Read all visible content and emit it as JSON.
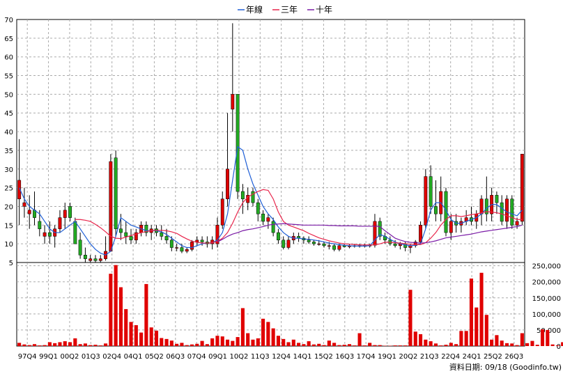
{
  "legend": [
    {
      "name": "年線",
      "color": "#1f5fd6"
    },
    {
      "name": "三年",
      "color": "#e8244a"
    },
    {
      "name": "十年",
      "color": "#7a1aa6"
    }
  ],
  "footer_text": "資料日期: 09/18  (Goodinfo.tw)",
  "chart_data": [
    {
      "type": "candlestick",
      "panel": "price",
      "ylim": [
        5,
        70
      ],
      "ytick_labels": [
        "5",
        "10",
        "15",
        "20",
        "25",
        "30",
        "35",
        "40",
        "45",
        "50",
        "55",
        "60",
        "65",
        "70"
      ],
      "xtick_labels": [
        "97Q4",
        "99Q1",
        "00Q2",
        "01Q3",
        "02Q4",
        "04Q1",
        "05Q2",
        "06Q3",
        "07Q4",
        "09Q1",
        "10Q2",
        "11Q3",
        "12Q4",
        "14Q1",
        "15Q2",
        "16Q3",
        "17Q4",
        "19Q1",
        "20Q2",
        "21Q3",
        "22Q4",
        "24Q1",
        "25Q2",
        "26Q3"
      ],
      "up_color": "#e00000",
      "down_color": "#22aa22",
      "candles": [
        {
          "o": 22,
          "h": 38,
          "l": 15,
          "c": 27
        },
        {
          "o": 20,
          "h": 25,
          "l": 17,
          "c": 21
        },
        {
          "o": 18,
          "h": 23,
          "l": 14,
          "c": 19
        },
        {
          "o": 19,
          "h": 24,
          "l": 15,
          "c": 17
        },
        {
          "o": 16,
          "h": 19,
          "l": 12,
          "c": 14
        },
        {
          "o": 12,
          "h": 15,
          "l": 10,
          "c": 13
        },
        {
          "o": 13,
          "h": 16,
          "l": 10,
          "c": 12
        },
        {
          "o": 12,
          "h": 15,
          "l": 9,
          "c": 14
        },
        {
          "o": 14,
          "h": 19,
          "l": 13,
          "c": 17
        },
        {
          "o": 17,
          "h": 21,
          "l": 14,
          "c": 19
        },
        {
          "o": 20,
          "h": 21,
          "l": 16,
          "c": 17
        },
        {
          "o": 16,
          "h": 17,
          "l": 10,
          "c": 10
        },
        {
          "o": 11,
          "h": 13,
          "l": 6,
          "c": 7
        },
        {
          "o": 7,
          "h": 9,
          "l": 5,
          "c": 6
        },
        {
          "o": 5.5,
          "h": 7,
          "l": 5,
          "c": 6
        },
        {
          "o": 6,
          "h": 7,
          "l": 5,
          "c": 5.5
        },
        {
          "o": 5.5,
          "h": 7,
          "l": 5,
          "c": 6
        },
        {
          "o": 6,
          "h": 12,
          "l": 5.5,
          "c": 8
        },
        {
          "o": 8,
          "h": 34,
          "l": 8,
          "c": 32
        },
        {
          "o": 33,
          "h": 35,
          "l": 12,
          "c": 14
        },
        {
          "o": 14,
          "h": 18,
          "l": 11,
          "c": 13
        },
        {
          "o": 13,
          "h": 16,
          "l": 10,
          "c": 12
        },
        {
          "o": 12,
          "h": 14,
          "l": 10,
          "c": 11
        },
        {
          "o": 11,
          "h": 14,
          "l": 10,
          "c": 13
        },
        {
          "o": 13,
          "h": 16,
          "l": 12,
          "c": 15
        },
        {
          "o": 15,
          "h": 16,
          "l": 12,
          "c": 13
        },
        {
          "o": 13,
          "h": 15,
          "l": 11,
          "c": 14
        },
        {
          "o": 14,
          "h": 15,
          "l": 12,
          "c": 13
        },
        {
          "o": 13,
          "h": 15,
          "l": 11,
          "c": 12
        },
        {
          "o": 12,
          "h": 14,
          "l": 10,
          "c": 11
        },
        {
          "o": 11,
          "h": 12,
          "l": 8,
          "c": 9
        },
        {
          "o": 9,
          "h": 10,
          "l": 8,
          "c": 9
        },
        {
          "o": 9,
          "h": 10,
          "l": 7.5,
          "c": 8
        },
        {
          "o": 8,
          "h": 9,
          "l": 7.5,
          "c": 8.5
        },
        {
          "o": 8.5,
          "h": 11,
          "l": 8,
          "c": 10.5
        },
        {
          "o": 10.5,
          "h": 12,
          "l": 9.5,
          "c": 11
        },
        {
          "o": 11,
          "h": 12,
          "l": 9.5,
          "c": 10.5
        },
        {
          "o": 10.5,
          "h": 12,
          "l": 9,
          "c": 10
        },
        {
          "o": 10,
          "h": 12,
          "l": 8.5,
          "c": 11
        },
        {
          "o": 10,
          "h": 17,
          "l": 9,
          "c": 15
        },
        {
          "o": 15,
          "h": 24,
          "l": 14,
          "c": 22
        },
        {
          "o": 22,
          "h": 45,
          "l": 20,
          "c": 30
        },
        {
          "o": 46,
          "h": 69,
          "l": 40,
          "c": 50
        },
        {
          "o": 50,
          "h": 50,
          "l": 22,
          "c": 24
        },
        {
          "o": 24,
          "h": 26,
          "l": 18,
          "c": 22
        },
        {
          "o": 21,
          "h": 25,
          "l": 19,
          "c": 23
        },
        {
          "o": 24,
          "h": 25,
          "l": 20,
          "c": 21
        },
        {
          "o": 21,
          "h": 22,
          "l": 16,
          "c": 18
        },
        {
          "o": 18,
          "h": 19,
          "l": 15,
          "c": 16
        },
        {
          "o": 16,
          "h": 18,
          "l": 14,
          "c": 17
        },
        {
          "o": 16,
          "h": 17,
          "l": 12,
          "c": 13
        },
        {
          "o": 13,
          "h": 14,
          "l": 10,
          "c": 11
        },
        {
          "o": 11,
          "h": 12,
          "l": 8.5,
          "c": 9
        },
        {
          "o": 9,
          "h": 12,
          "l": 8.5,
          "c": 11
        },
        {
          "o": 11,
          "h": 13,
          "l": 10,
          "c": 12
        },
        {
          "o": 12,
          "h": 13,
          "l": 10.5,
          "c": 11.5
        },
        {
          "o": 11.5,
          "h": 12,
          "l": 10,
          "c": 11
        },
        {
          "o": 11,
          "h": 12,
          "l": 10,
          "c": 10.5
        },
        {
          "o": 10.5,
          "h": 11,
          "l": 9.5,
          "c": 10
        },
        {
          "o": 10,
          "h": 11,
          "l": 9.5,
          "c": 10
        },
        {
          "o": 10,
          "h": 10.5,
          "l": 9,
          "c": 9.5
        },
        {
          "o": 9.5,
          "h": 10.5,
          "l": 8.5,
          "c": 9.5
        },
        {
          "o": 9.5,
          "h": 10,
          "l": 8,
          "c": 8.5
        },
        {
          "o": 8.5,
          "h": 10,
          "l": 8,
          "c": 9.5
        },
        {
          "o": 9.5,
          "h": 10,
          "l": 9,
          "c": 9.2
        },
        {
          "o": 9.2,
          "h": 10,
          "l": 8.8,
          "c": 9.5
        },
        {
          "o": 9.5,
          "h": 10,
          "l": 9,
          "c": 9.3
        },
        {
          "o": 9.3,
          "h": 10,
          "l": 9,
          "c": 9.5
        },
        {
          "o": 9.5,
          "h": 10,
          "l": 9,
          "c": 9.4
        },
        {
          "o": 9.4,
          "h": 10,
          "l": 9,
          "c": 9.6
        },
        {
          "o": 9.6,
          "h": 18,
          "l": 9,
          "c": 16
        },
        {
          "o": 16,
          "h": 17,
          "l": 11,
          "c": 12
        },
        {
          "o": 12,
          "h": 13,
          "l": 10,
          "c": 11
        },
        {
          "o": 11,
          "h": 12,
          "l": 9.5,
          "c": 10
        },
        {
          "o": 10,
          "h": 11,
          "l": 9,
          "c": 9.5
        },
        {
          "o": 9.5,
          "h": 10.5,
          "l": 8.5,
          "c": 10
        },
        {
          "o": 10,
          "h": 10.5,
          "l": 8,
          "c": 9
        },
        {
          "o": 9,
          "h": 10,
          "l": 7.5,
          "c": 9.5
        },
        {
          "o": 9.5,
          "h": 11,
          "l": 9,
          "c": 10.5
        },
        {
          "o": 10.5,
          "h": 16,
          "l": 10,
          "c": 15
        },
        {
          "o": 15,
          "h": 30,
          "l": 14,
          "c": 28
        },
        {
          "o": 28,
          "h": 31,
          "l": 18,
          "c": 20
        },
        {
          "o": 20,
          "h": 27,
          "l": 16,
          "c": 18
        },
        {
          "o": 18,
          "h": 28,
          "l": 16,
          "c": 24
        },
        {
          "o": 24,
          "h": 25,
          "l": 12,
          "c": 13
        },
        {
          "o": 13,
          "h": 18,
          "l": 11,
          "c": 16
        },
        {
          "o": 16,
          "h": 18,
          "l": 13,
          "c": 15
        },
        {
          "o": 15,
          "h": 17,
          "l": 13,
          "c": 16
        },
        {
          "o": 16,
          "h": 19,
          "l": 15,
          "c": 17
        },
        {
          "o": 17,
          "h": 20,
          "l": 15,
          "c": 16
        },
        {
          "o": 16,
          "h": 19,
          "l": 14,
          "c": 18
        },
        {
          "o": 18,
          "h": 23,
          "l": 15,
          "c": 22
        },
        {
          "o": 22,
          "h": 28,
          "l": 16,
          "c": 18
        },
        {
          "o": 18,
          "h": 25,
          "l": 16,
          "c": 23
        },
        {
          "o": 23,
          "h": 24,
          "l": 18,
          "c": 21
        },
        {
          "o": 21,
          "h": 23,
          "l": 15,
          "c": 16
        },
        {
          "o": 16,
          "h": 23,
          "l": 14,
          "c": 22
        },
        {
          "o": 22,
          "h": 23,
          "l": 14,
          "c": 15
        },
        {
          "o": 15,
          "h": 17,
          "l": 14,
          "c": 16
        },
        {
          "o": 16,
          "h": 34,
          "l": 15,
          "c": 34
        }
      ],
      "series": [
        {
          "name": "年線",
          "color": "#1f5fd6",
          "values": [
            25,
            22,
            20,
            19,
            18,
            16,
            14,
            13,
            13,
            14,
            15,
            16,
            14,
            12,
            10,
            8.5,
            7.5,
            7,
            8,
            12,
            17,
            16,
            15,
            14.5,
            14,
            13.5,
            13.5,
            13.5,
            13.2,
            12.5,
            11.5,
            10.5,
            9.5,
            9,
            9,
            9.5,
            10,
            10.2,
            10.3,
            11,
            13,
            18,
            27,
            36,
            35,
            30,
            26,
            23,
            20,
            18,
            16.5,
            14.5,
            13,
            12,
            11.5,
            11.5,
            11.3,
            11.2,
            11,
            10.8,
            10.5,
            10.2,
            10,
            9.8,
            9.6,
            9.5,
            9.4,
            9.4,
            9.4,
            9.5,
            11,
            12.5,
            12,
            11.2,
            10.5,
            10,
            9.7,
            9.5,
            9.6,
            10,
            14,
            19,
            21,
            21,
            19,
            16.5,
            15.5,
            15.5,
            16,
            16.5,
            17,
            18,
            19.5,
            20.5,
            20.5,
            19.5,
            18.5,
            18,
            17.5,
            19
          ]
        },
        {
          "name": "三年",
          "color": "#e8244a",
          "values": [
            null,
            null,
            null,
            null,
            null,
            null,
            null,
            null,
            null,
            null,
            null,
            16.5,
            16.5,
            16.3,
            16,
            15.2,
            14.3,
            13.2,
            12,
            11.5,
            11.4,
            11.8,
            12.2,
            12.6,
            13,
            13.3,
            13.5,
            13.6,
            13.6,
            13.5,
            13.2,
            12.8,
            12,
            11.3,
            10.7,
            10.4,
            10.2,
            10.2,
            10.3,
            10.6,
            11.5,
            13,
            15.5,
            18.5,
            21,
            22.5,
            23.3,
            24,
            24.5,
            24.3,
            22,
            18.5,
            16,
            15,
            14.5,
            14,
            13.5,
            12.8,
            12.2,
            11.6,
            11.2,
            10.8,
            10.5,
            10.2,
            10,
            9.9,
            9.8,
            9.7,
            9.7,
            9.7,
            9.7,
            10,
            10.4,
            10.4,
            10.3,
            10.2,
            10,
            9.9,
            9.8,
            9.8,
            10.3,
            11.5,
            13,
            15,
            16.5,
            17.5,
            17.5,
            17.3,
            17.5,
            17.8,
            18,
            18.3,
            18.6,
            18.5,
            18.3,
            18,
            17.5,
            17,
            16.5,
            16.5
          ]
        },
        {
          "name": "十年",
          "color": "#7a1aa6",
          "values": [
            null,
            null,
            null,
            null,
            null,
            null,
            null,
            null,
            null,
            null,
            null,
            null,
            null,
            null,
            null,
            null,
            null,
            null,
            null,
            null,
            null,
            null,
            null,
            null,
            null,
            null,
            null,
            null,
            null,
            null,
            null,
            null,
            null,
            null,
            null,
            null,
            null,
            null,
            null,
            10.5,
            11.2,
            12,
            12.6,
            13,
            13.5,
            13.8,
            14,
            14.3,
            14.6,
            15,
            15.2,
            15.3,
            15.4,
            15.3,
            15.2,
            15.1,
            15,
            15,
            15,
            15,
            15,
            14.9,
            14.9,
            14.8,
            14.8,
            14.8,
            14.8,
            14.7,
            14.7,
            14.7,
            14.7,
            14.6,
            13.5,
            12.5,
            11.5,
            11,
            10.6,
            10.4,
            10.3,
            10.2,
            10.3,
            10.5,
            10.8,
            11.2,
            11.6,
            11.8,
            12,
            12.2,
            12.4,
            12.6,
            12.9,
            13.2,
            13.4,
            13.6,
            13.8,
            14,
            14.2,
            14.4,
            14.6,
            15
          ]
        }
      ]
    },
    {
      "type": "bar",
      "panel": "volume",
      "ylim": [
        0,
        260000
      ],
      "ytick_labels": [
        "0",
        "50,000",
        "100,000",
        "150,000",
        "200,000",
        "250,000"
      ],
      "color": "#e00000",
      "values": [
        10000,
        5000,
        3000,
        6000,
        2000,
        3000,
        12000,
        9000,
        12000,
        15000,
        12000,
        24000,
        6000,
        8000,
        3000,
        4000,
        2000,
        8000,
        225000,
        252000,
        183000,
        115000,
        75000,
        65000,
        42000,
        193000,
        58000,
        48000,
        25000,
        22000,
        17000,
        7000,
        10000,
        3000,
        5000,
        7000,
        16000,
        6000,
        24000,
        32000,
        30000,
        20000,
        16000,
        28000,
        118000,
        40000,
        20000,
        24000,
        85000,
        75000,
        55000,
        32000,
        22000,
        12000,
        20000,
        10000,
        6000,
        15000,
        5000,
        7000,
        3000,
        17000,
        10000,
        3000,
        4000,
        6000,
        2000,
        40000,
        2000,
        10000,
        3000,
        3000,
        1000,
        1000,
        2000,
        2000,
        2000,
        175000,
        45000,
        37000,
        20000,
        15000,
        8000,
        2000,
        4000,
        10000,
        6000,
        47000,
        47000,
        210000,
        120000,
        228000,
        97000,
        20000,
        34000,
        17000,
        9000,
        8000,
        3000,
        40000,
        9000,
        16000,
        4000,
        52000,
        50000,
        5000,
        2000,
        12000,
        10000,
        14000,
        65000
      ]
    }
  ]
}
